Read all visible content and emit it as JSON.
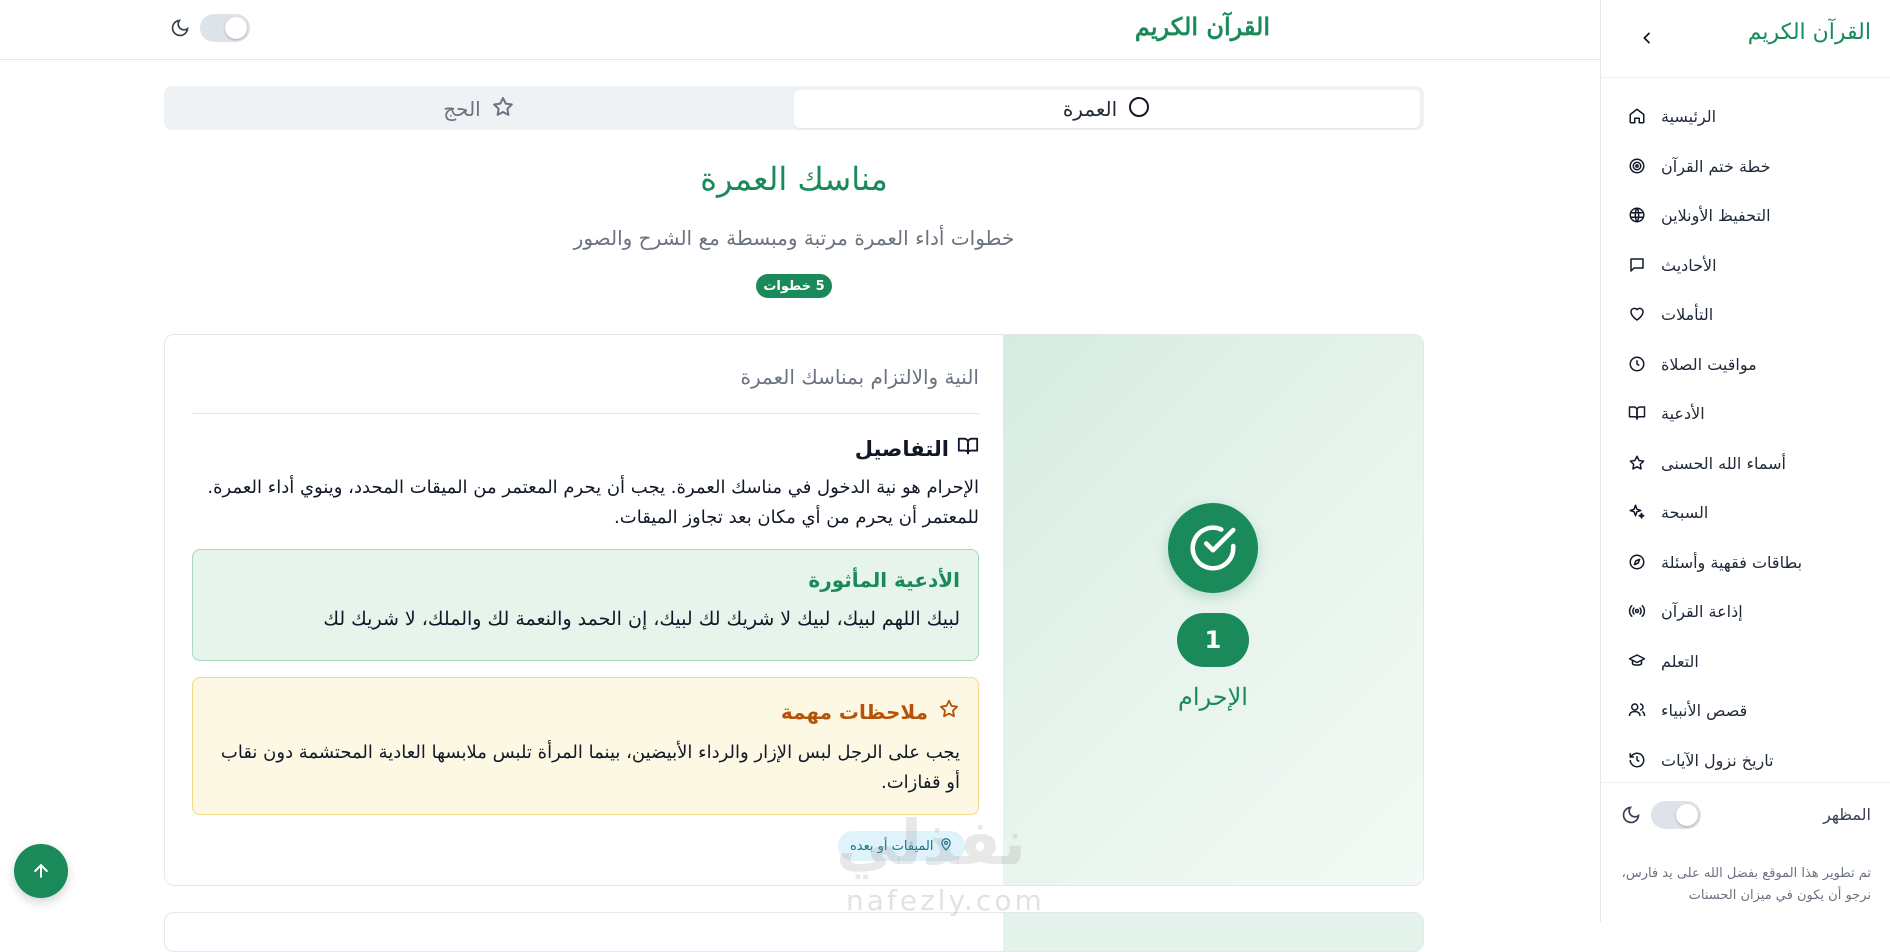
{
  "header": {
    "site_title": "القرآن الكريم"
  },
  "tabs": [
    {
      "label": "العمرة",
      "icon": "circle-icon",
      "active": true
    },
    {
      "label": "الحج",
      "icon": "star-icon",
      "active": false
    }
  ],
  "hero": {
    "title": "مناسك العمرة",
    "subtitle": "خطوات أداء العمرة مرتبة ومبسطة مع الشرح والصور",
    "steps_badge": "5 خطوات"
  },
  "step": {
    "number": "1",
    "name": "الإحرام",
    "intro": "النية والالتزام بمناسك العمرة",
    "details_heading": "التفاصيل",
    "details_text": "الإحرام هو نية الدخول في مناسك العمرة. يجب أن يحرم المعتمر من الميقات المحدد، وينوي أداء العمرة. للمعتمر أن يحرم من أي مكان بعد تجاوز الميقات.",
    "dua_title": "الأدعية المأثورة",
    "dua_text": "لبيك اللهم لبيك، لبيك لا شريك لك لبيك، إن الحمد والنعمة لك والملك، لا شريك لك",
    "notes_title": "ملاحظات مهمة",
    "notes_text": "يجب على الرجل لبس الإزار والرداء الأبيضين، بينما المرأة تلبس ملابسها العادية المحتشمة دون نقاب أو قفازات.",
    "location_chip": "الميقات أو بعده"
  },
  "watermark": {
    "arabic": "نفذلي",
    "latin": "nafezly.com"
  },
  "sidebar": {
    "title": "القرآن الكريم",
    "items": [
      {
        "label": "الرئيسية",
        "icon": "home-icon"
      },
      {
        "label": "خطة ختم القرآن",
        "icon": "target-icon"
      },
      {
        "label": "التحفيظ الأونلاين",
        "icon": "globe-icon"
      },
      {
        "label": "الأحاديث",
        "icon": "message-icon"
      },
      {
        "label": "التأملات",
        "icon": "heart-icon"
      },
      {
        "label": "مواقيت الصلاة",
        "icon": "clock-icon"
      },
      {
        "label": "الأدعية",
        "icon": "book-open-icon"
      },
      {
        "label": "أسماء الله الحسنى",
        "icon": "star-icon"
      },
      {
        "label": "السبحة",
        "icon": "sparkles-icon"
      },
      {
        "label": "بطاقات فقهية وأسئلة",
        "icon": "compass-icon"
      },
      {
        "label": "إذاعة القرآن",
        "icon": "radio-icon"
      },
      {
        "label": "التعلم",
        "icon": "graduation-cap-icon"
      },
      {
        "label": "قصص الأنبياء",
        "icon": "users-icon"
      },
      {
        "label": "تاريخ نزول الآيات",
        "icon": "history-icon"
      }
    ],
    "appearance_label": "المظهر",
    "credit": "تم تطوير هذا الموقع بفضل الله على يد فارس، نرجو أن يكون في ميزان الحسنات"
  },
  "colors": {
    "brand_green": "#1a8a5a",
    "notes_amber": "#b45309",
    "dua_bg": "#e6f4ec",
    "notes_bg": "#fdf8e4"
  }
}
